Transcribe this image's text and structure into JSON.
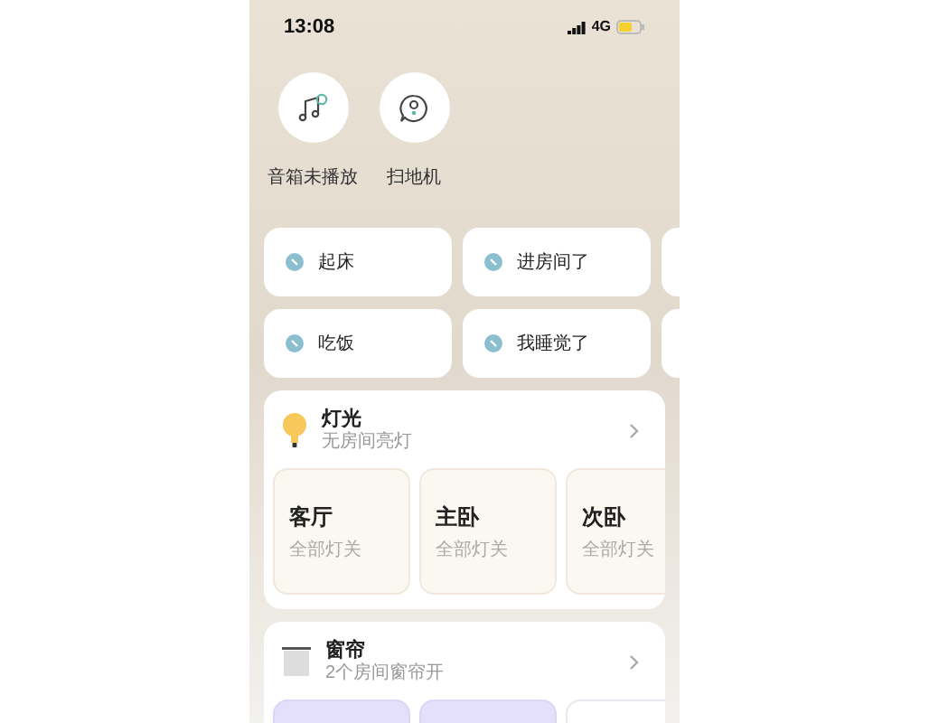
{
  "status_bar": {
    "time": "13:08",
    "network": "4G"
  },
  "devices": [
    {
      "kind": "speaker",
      "label": "音箱未播放"
    },
    {
      "kind": "vacuum",
      "label": "扫地机"
    }
  ],
  "scenes": [
    [
      "起床",
      "进房间了"
    ],
    [
      "吃饭",
      "我睡觉了"
    ]
  ],
  "sections": [
    {
      "kind": "light",
      "title": "灯光",
      "subtitle": "无房间亮灯",
      "rooms": [
        {
          "name": "客厅",
          "status": "全部灯关"
        },
        {
          "name": "主卧",
          "status": "全部灯关"
        },
        {
          "name": "次卧",
          "status": "全部灯关"
        }
      ]
    },
    {
      "kind": "curtain",
      "title": "窗帘",
      "subtitle": "2个房间窗帘开",
      "rooms": [
        {
          "open": true
        },
        {
          "open": true
        },
        {
          "open": false
        }
      ]
    }
  ]
}
